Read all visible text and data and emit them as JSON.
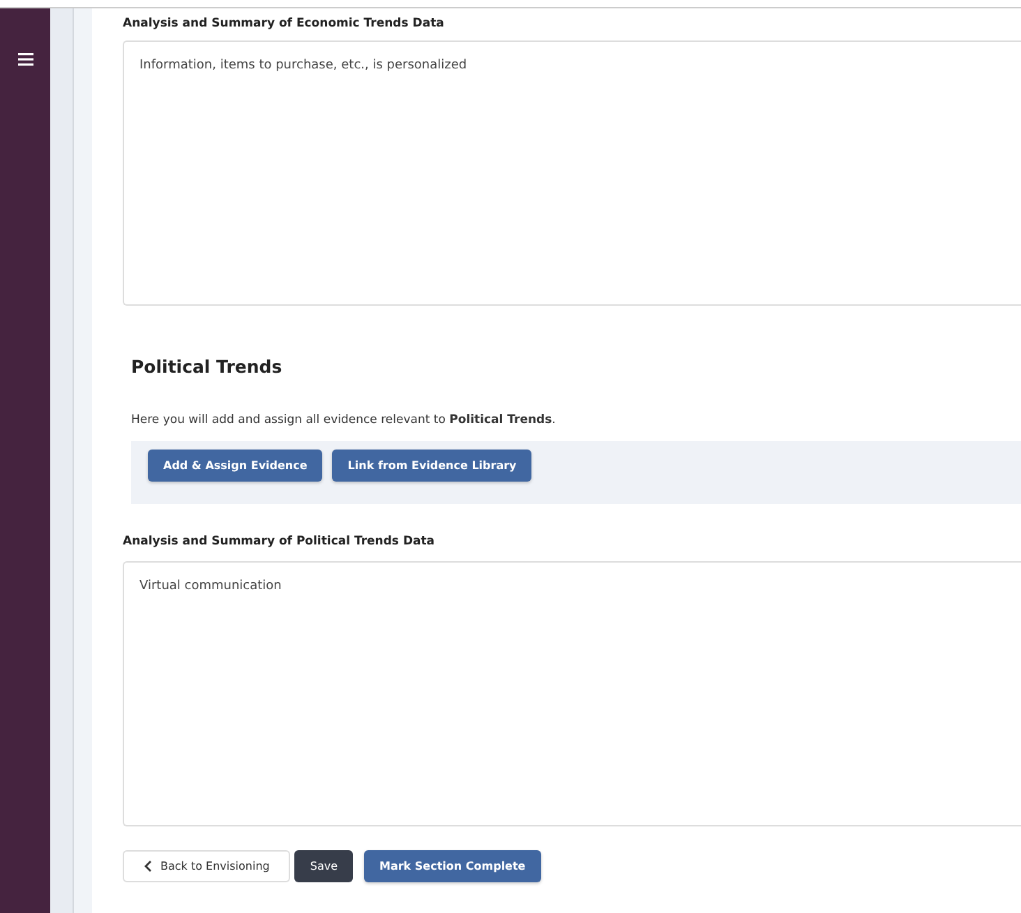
{
  "economic": {
    "label": "Analysis and Summary of Economic Trends Data",
    "value": "Information, items to purchase, etc., is personalized"
  },
  "political": {
    "heading": "Political Trends",
    "intro": "Here you will add and assign all evidence relevant to **Political Trends**.",
    "buttons": [
      "Add & Assign Evidence",
      "Link from Evidence Library"
    ],
    "label": "Analysis and Summary of Political Trends Data",
    "value": "Virtual communication"
  },
  "footer": {
    "back": "Back to Envisioning",
    "save": "Save",
    "complete": "Mark Section Complete"
  }
}
